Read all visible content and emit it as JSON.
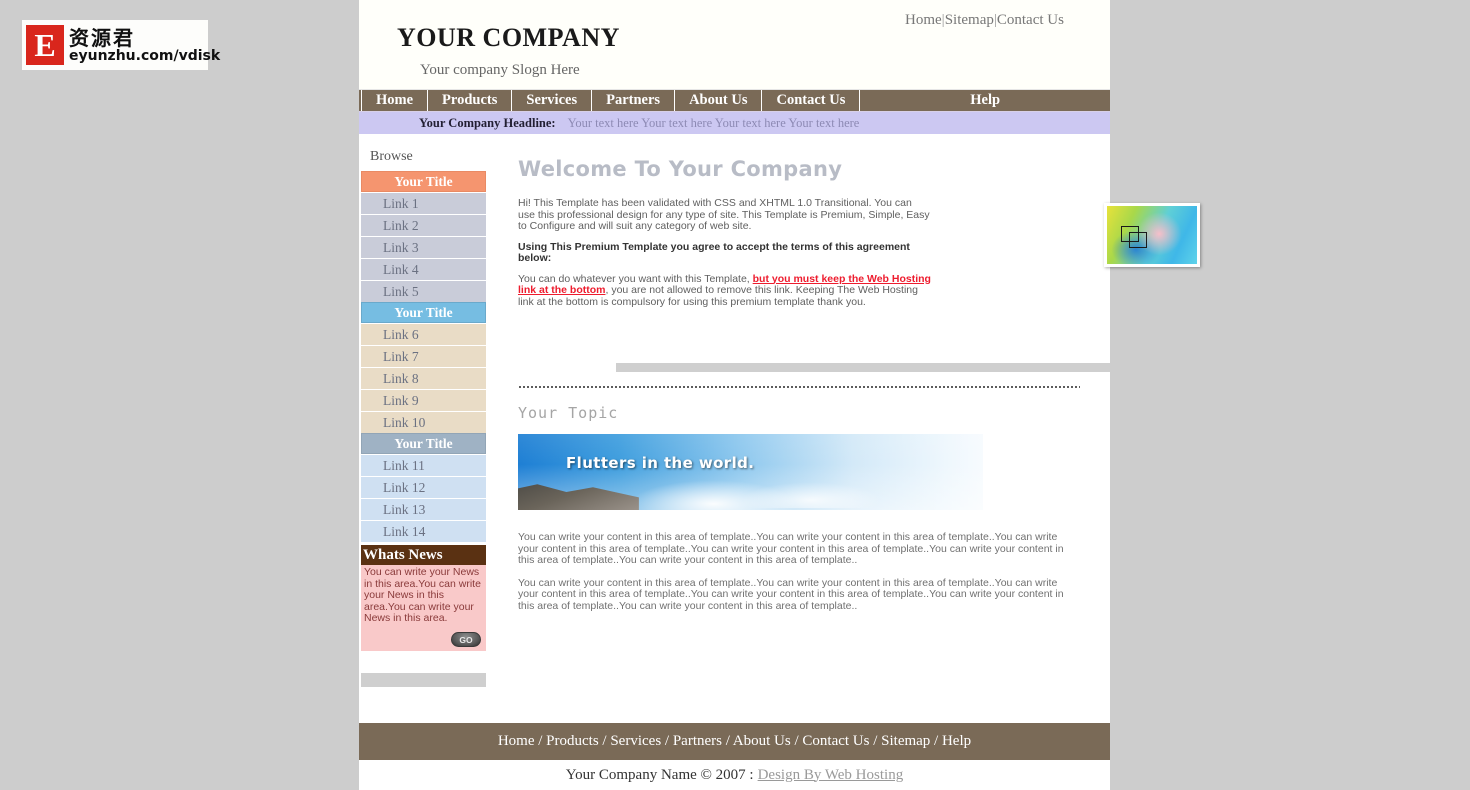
{
  "watermark": {
    "badge_letter": "E",
    "cn_text": "资源君",
    "url_text": "eyunzhu.com/vdisk"
  },
  "header": {
    "company_name": "YOUR COMPANY",
    "slogan": "Your company Slogn Here",
    "top_links": [
      {
        "label": "Home"
      },
      {
        "label": "Sitemap"
      },
      {
        "label": "Contact Us"
      }
    ],
    "separator": "|"
  },
  "main_nav": {
    "items": [
      {
        "label": "Home"
      },
      {
        "label": "Products"
      },
      {
        "label": "Services"
      },
      {
        "label": "Partners"
      },
      {
        "label": "About Us"
      },
      {
        "label": "Contact Us"
      },
      {
        "label": "Help"
      }
    ]
  },
  "headline": {
    "label": "Your Company Headline:",
    "text": "Your text here Your text here Your text here Your text here"
  },
  "sidebar": {
    "browse_label": "Browse",
    "groups": [
      {
        "title": "Your Title",
        "links": [
          {
            "label": "Link 1"
          },
          {
            "label": "Link 2"
          },
          {
            "label": "Link 3"
          },
          {
            "label": "Link 4"
          },
          {
            "label": "Link 5"
          }
        ]
      },
      {
        "title": "Your Title",
        "links": [
          {
            "label": "Link 6"
          },
          {
            "label": "Link 7"
          },
          {
            "label": "Link 8"
          },
          {
            "label": "Link 9"
          },
          {
            "label": "Link 10"
          }
        ]
      },
      {
        "title": "Your Title",
        "links": [
          {
            "label": "Link 11"
          },
          {
            "label": "Link 12"
          },
          {
            "label": "Link 13"
          },
          {
            "label": "Link 14"
          }
        ]
      }
    ],
    "news": {
      "title": "Whats News",
      "text": "You can write your News in this area.You can write your News in this area.You can write your News in this area.",
      "go_label": "GO"
    }
  },
  "welcome": {
    "title": "Welcome To Your Company",
    "paragraph1": "Hi! This Template has been validated with CSS and XHTML 1.0 Transitional. You can use this professional design for any type of site. This Template is Premium, Simple, Easy to Configure and will suit any category of web site.",
    "paragraph2": "Using This Premium Template you agree to accept the terms of this agreement below:",
    "paragraph3_a": "You can do whatever you want with this Template, ",
    "paragraph3_red": "but you must keep the Web Hosting link at the bottom",
    "paragraph3_b": ", you are not allowed to remove this link. Keeping The Web Hosting link at the bottom is compulsory for using this premium template thank you.",
    "image_name": "broken-image-placeholder"
  },
  "topic": {
    "title": "Your Topic",
    "banner_text": "Flutters in the world.",
    "paragraph1": "You can write your content in this area of template..You can write your content in this area of template..You can write your content in this area of template..You can write your content in this area of template..You can write your content in this area of template..You can write your content in this area of template..",
    "paragraph2": "You can write your content in this area of template..You can write your content in this area of template..You can write your content in this area of template..You can write your content in this area of template..You can write your content in this area of template..You can write your content in this area of template.."
  },
  "footer": {
    "nav_text": "Home / Products / Services / Partners / About Us / Contact Us / Sitemap / Help",
    "copyright": "Your Company Name © 2007 :",
    "design_by": "Design By Web Hosting"
  },
  "colors": {
    "nav_brown": "#7a6a57",
    "headline_purple": "#ccc8f2",
    "title_orange": "#f5956f",
    "title_blue": "#76bde2",
    "title_slate": "#9fb2c4",
    "news_brown": "#5a3112",
    "news_pink": "#f9c9c9",
    "accent_red": "#ee1c2e",
    "page_bg": "#cdcdcd"
  }
}
